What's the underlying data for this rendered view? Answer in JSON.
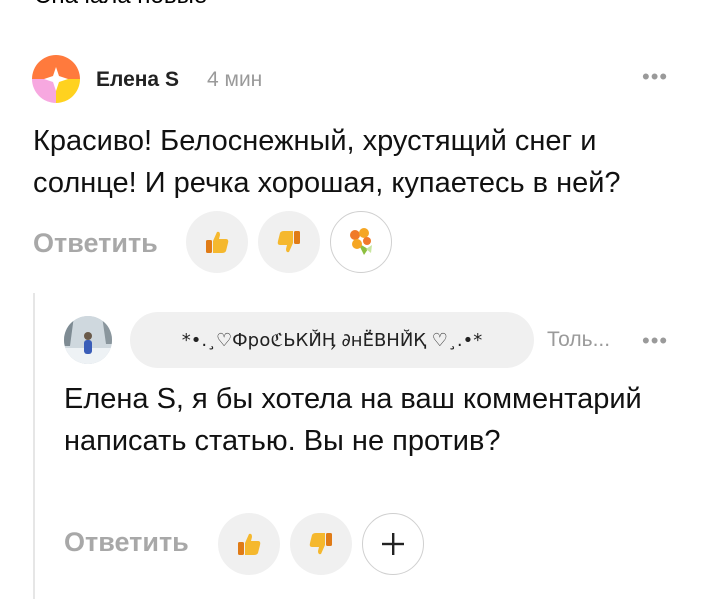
{
  "sort_label": "Сначала новые",
  "comment1": {
    "author": "Елена S",
    "time": "4 мин",
    "text": "Красиво! Белоснежный, хрустящий снег и солнце! И речка хорошая, купаетесь в ней?",
    "reply_label": "Ответить",
    "more": "•••"
  },
  "comment2": {
    "author": "*•.¸♡Фр໐ℭЬКЙ̆Ӊ ∂нЁ̂ВНЙ̆Қ ♡¸.•*",
    "time": "Толь...",
    "text": "Елена S, я бы хотела на ваш комментарий написать статью. Вы не против?",
    "reply_label": "Ответить",
    "more": "•••"
  },
  "icons": {
    "like": "thumbs-up-icon",
    "dislike": "thumbs-down-icon",
    "bouquet": "flower-bouquet-icon",
    "add": "plus-icon"
  }
}
